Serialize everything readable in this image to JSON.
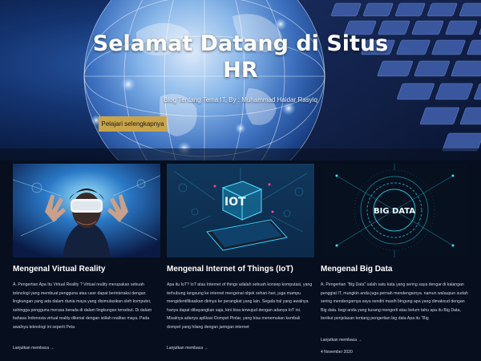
{
  "hero": {
    "title": "Selamat Datang di Situs HR",
    "subtitle": "Blog Tentang Tema IT, By : Muhammad Haidar Rasyiq",
    "cta_label": "Pelajari selengkapnya",
    "accent_color": "#c9a44a"
  },
  "posts": [
    {
      "title": "Mengenal Virtual Reality",
      "excerpt": "A. Pengertian Apa Itu Virtual Reality ? Virtual reality merupakan sebuah teknologi yang membuat pengguna atau user dapat berinteraksi dengan lingkungan yang ada dalam dunia maya yang disimulasikan oleh komputer, sehingga pengguna merasa berada di dalam lingkungan tersebut. Di dalam bahasa Indonesia virtual reality dikenal dengan istilah realitas maya. Pada awalnya teknologi ini seperti Peta",
      "read_more": "Lanjutkan membaca  →",
      "image_text": ""
    },
    {
      "title": "Mengenal Internet of Things (IoT)",
      "excerpt": "Apa itu IoT? IoT atau Internet of things adalah sebuah konsep komputasi, yang terhubung langsung ke internet mengenai objek sehari-hari, juga mampu mengidentifikasikan dirinya ke perangkat yang lain. Segala hal yang awalnya hanya dapat dibayangkan saja, kini bisa terwujud dengan adanya IoT ini. Misalnya adanya aplikasi Dompet Pintar, yang bisa menemukan kembali dompet yang hilang dengan jaringan internet",
      "read_more": "Lanjutkan membaca  →",
      "image_text": "IOT"
    },
    {
      "title": "Mengenal Big Data",
      "excerpt": "A. Pengertian “Big Data” salah satu kata yang sering saya dengar di kalangan penggiat IT, mungkin anda juga pernah mendengarnya. namun walaupun sudah sering mendengarnya saya sendiri masih bingung apa yang dimaksud dengan Big data. bagi anda yang kurang mengerti atau belum tahu apa itu Big Data, berikut penjelasan tentang pengertian big data Apa itu “Big",
      "read_more": "Lanjutkan membaca  →",
      "date": "4 November 2020",
      "image_text": "BIG DATA"
    }
  ]
}
